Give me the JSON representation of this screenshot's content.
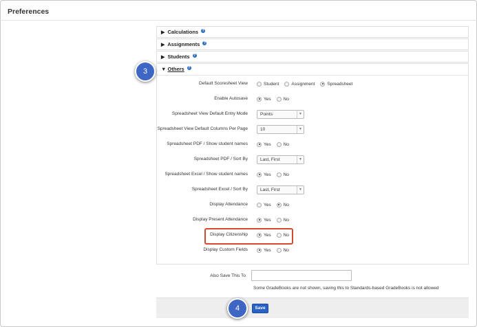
{
  "page": {
    "title": "Preferences"
  },
  "sections": [
    {
      "label": "Calculations",
      "chevron": "▶"
    },
    {
      "label": "Assignments",
      "chevron": "▶"
    },
    {
      "label": "Students",
      "chevron": "▶"
    }
  ],
  "others": {
    "label": "Others",
    "chevron": "▼",
    "help": "?",
    "rows": [
      {
        "label": "Default Scoresheet View",
        "type": "radio",
        "options": [
          {
            "text": "Student",
            "selected": false
          },
          {
            "text": "Assignment",
            "selected": false
          },
          {
            "text": "Spreadsheet",
            "selected": true
          }
        ]
      },
      {
        "label": "Enable Autosave",
        "type": "radio",
        "options": [
          {
            "text": "Yes",
            "selected": true
          },
          {
            "text": "No",
            "selected": false
          }
        ]
      },
      {
        "label": "Spreadsheet View Default Entry Mode",
        "type": "select",
        "value": "Points"
      },
      {
        "label": "Spreadsheet View Default Columns Per Page",
        "type": "select",
        "value": "10"
      },
      {
        "label": "Spreadsheet PDF / Show student names",
        "type": "radio",
        "options": [
          {
            "text": "Yes",
            "selected": true
          },
          {
            "text": "No",
            "selected": false
          }
        ]
      },
      {
        "label": "Spreadsheet PDF / Sort By",
        "type": "select",
        "value": "Last, First"
      },
      {
        "label": "Spreadsheet Excel / Show student names",
        "type": "radio",
        "options": [
          {
            "text": "Yes",
            "selected": true
          },
          {
            "text": "No",
            "selected": false
          }
        ]
      },
      {
        "label": "Spreadsheet Excel / Sort By",
        "type": "select",
        "value": "Last, First"
      },
      {
        "label": "Display Attendance",
        "type": "radio",
        "options": [
          {
            "text": "Yes",
            "selected": false
          },
          {
            "text": "No",
            "selected": true
          }
        ]
      },
      {
        "label": "Display Present Attendance",
        "type": "radio",
        "options": [
          {
            "text": "Yes",
            "selected": true
          },
          {
            "text": "No",
            "selected": false
          }
        ]
      },
      {
        "label": "Display Citizenship",
        "type": "radio",
        "options": [
          {
            "text": "Yes",
            "selected": true
          },
          {
            "text": "No",
            "selected": false
          }
        ]
      },
      {
        "label": "Display Custom Fields",
        "type": "radio",
        "options": [
          {
            "text": "Yes",
            "selected": true
          },
          {
            "text": "No",
            "selected": false
          }
        ]
      }
    ]
  },
  "also_save": {
    "label": "Also Save This To",
    "value": "",
    "note": "Some GradeBooks are not shown, saving this to Standards-based GradeBooks is not allowed"
  },
  "save_button": {
    "label": "Save"
  },
  "callouts": {
    "step3": "3",
    "step4": "4"
  },
  "colors": {
    "accent": "#2a61c4",
    "callout": "#3e66c4",
    "highlight": "#d24a2b"
  },
  "icons": {
    "help": "question-circle-icon",
    "collapsed": "chevron-right-icon",
    "expanded": "chevron-down-icon",
    "select_arrow": "dropdown-arrow-icon"
  }
}
